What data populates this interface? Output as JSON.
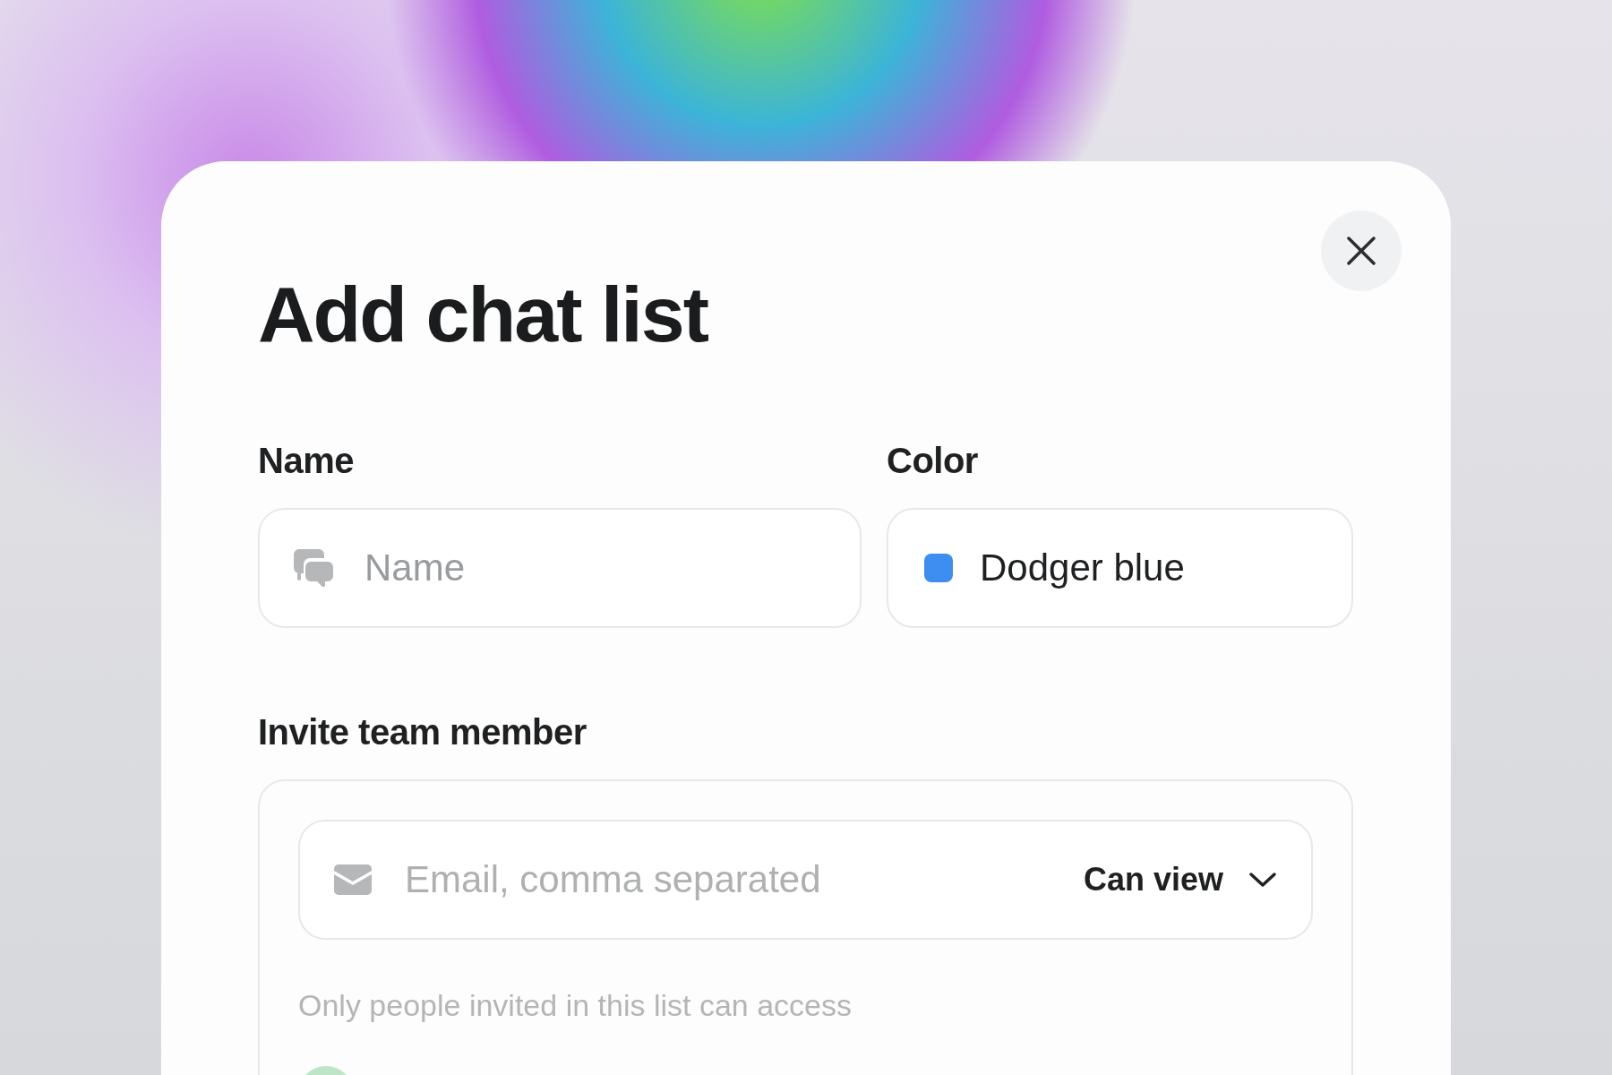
{
  "dialog": {
    "title": "Add chat list"
  },
  "name_field": {
    "label": "Name",
    "placeholder": "Name"
  },
  "color_field": {
    "label": "Color",
    "value": "Dodger blue",
    "color": "#3d8ef0"
  },
  "invite": {
    "label": "Invite team member",
    "email_placeholder": "Email, comma separated",
    "permission": "Can view",
    "note": "Only people invited in this list can access"
  }
}
